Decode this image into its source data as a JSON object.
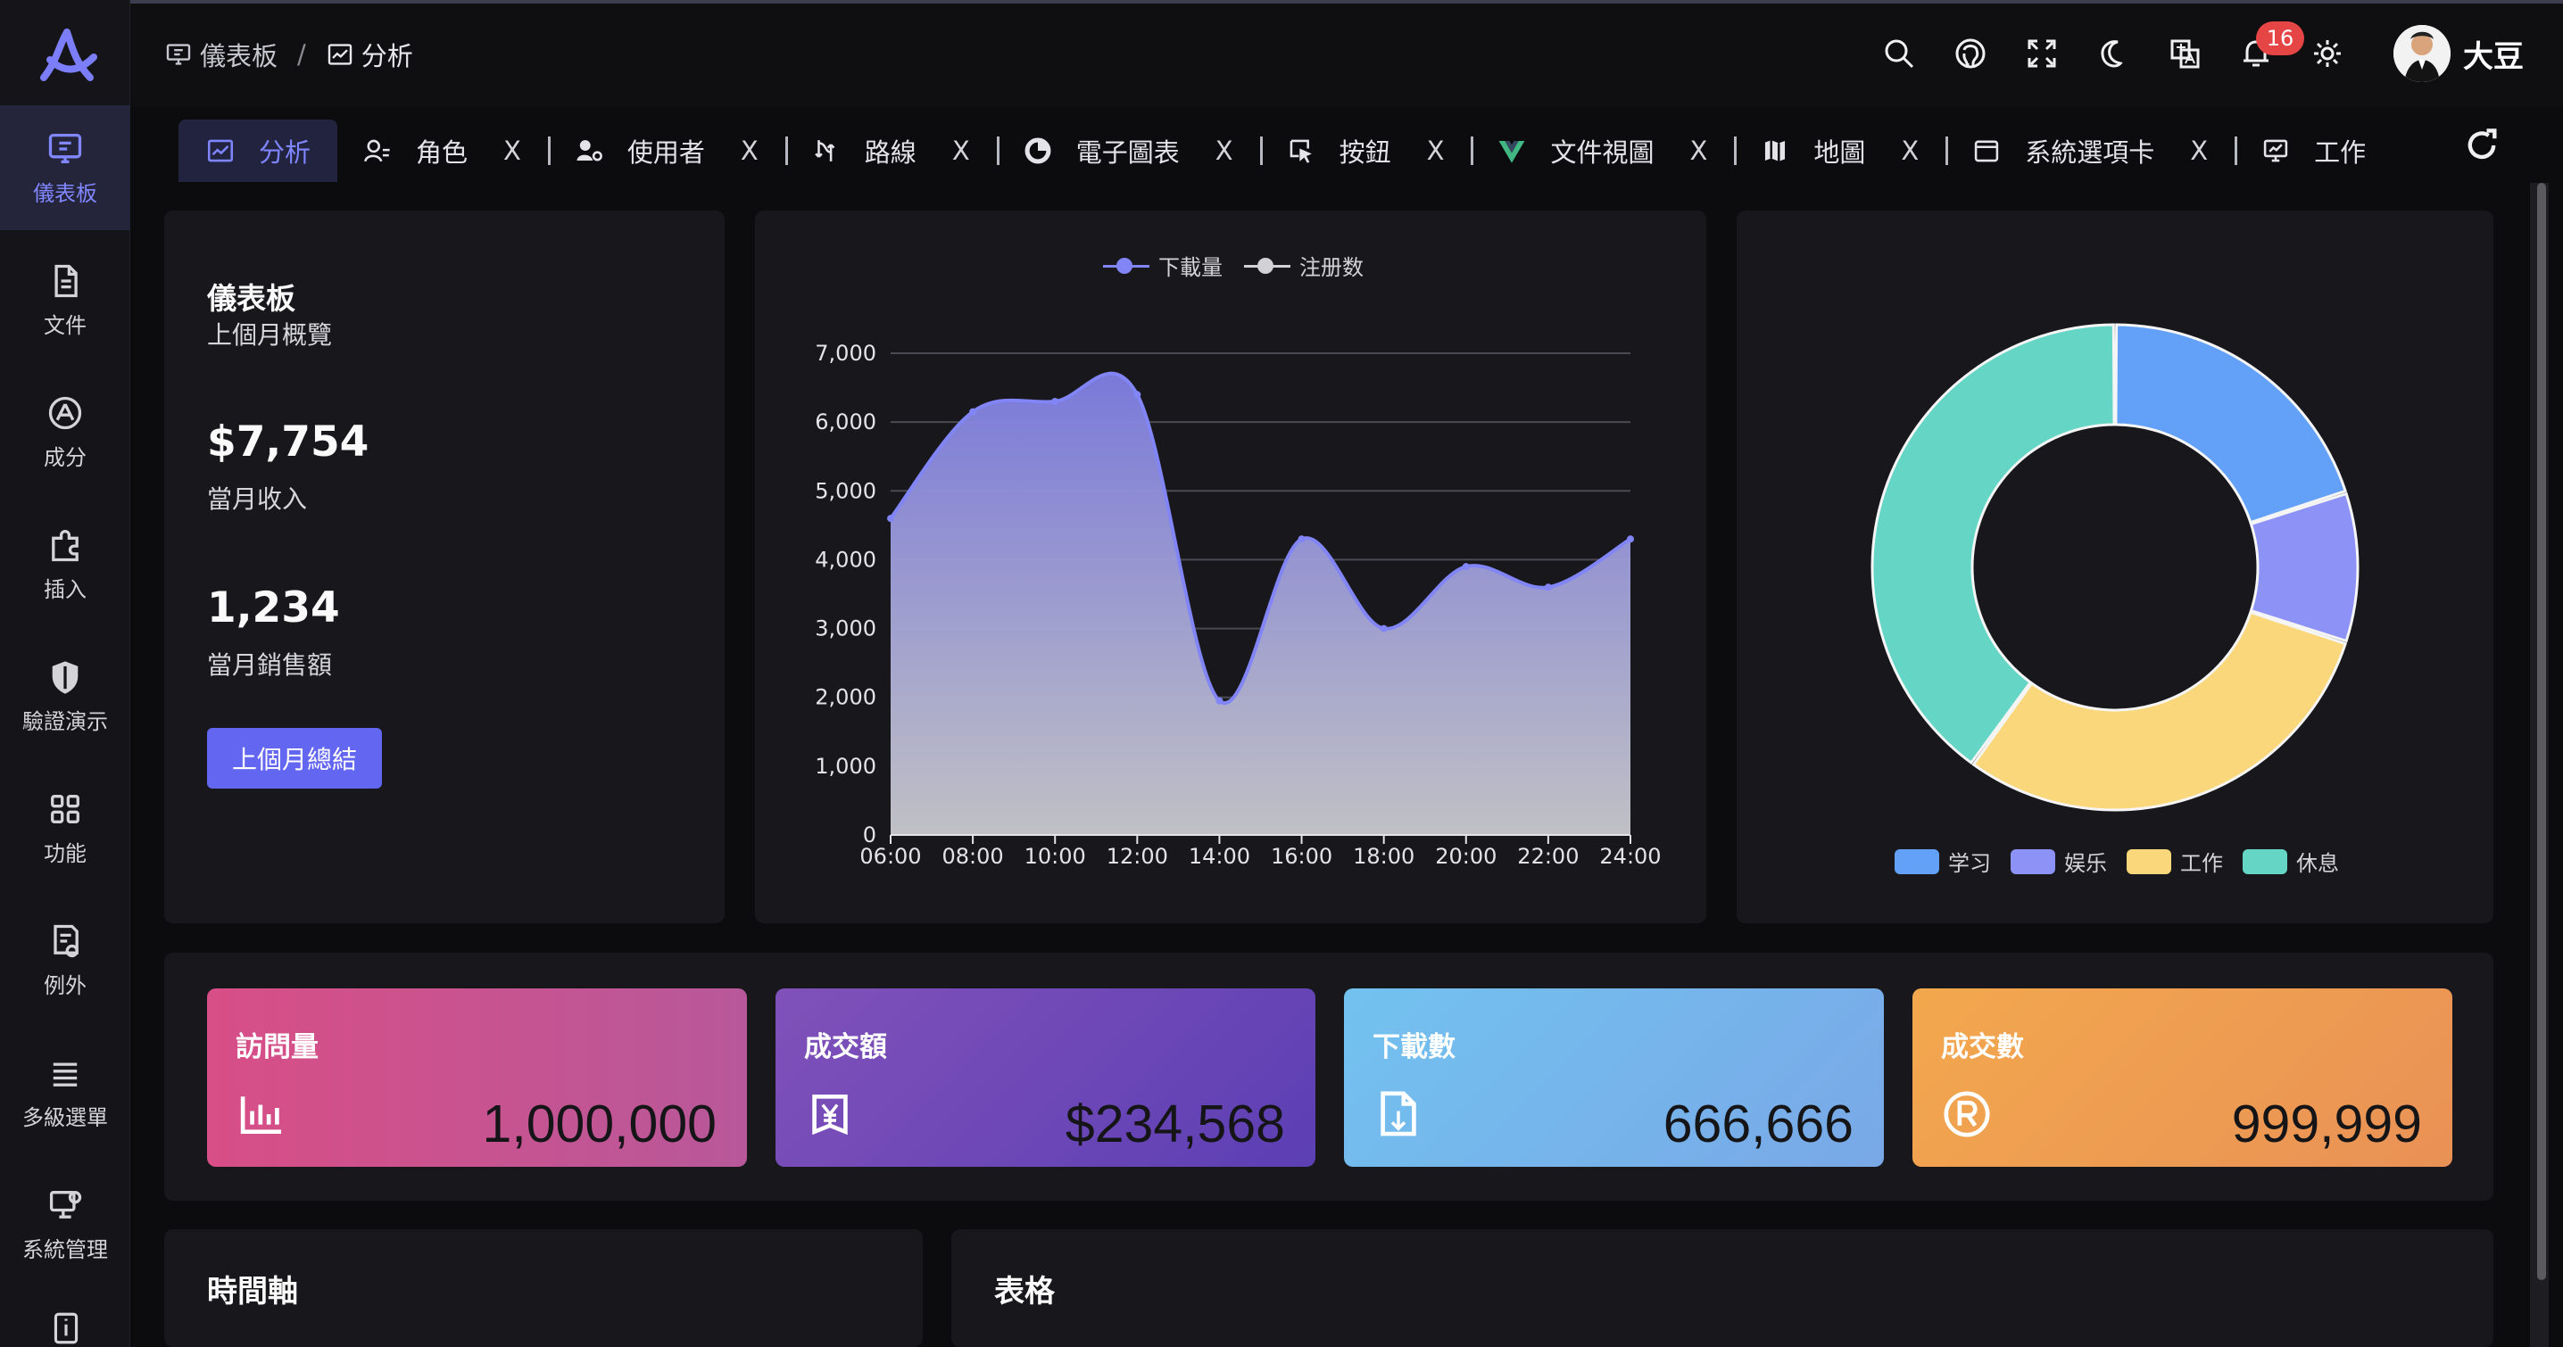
{
  "sidebar": {
    "items": [
      {
        "label": "儀表板",
        "icon": "dashboard-icon"
      },
      {
        "label": "文件",
        "icon": "document-icon"
      },
      {
        "label": "成分",
        "icon": "component-icon"
      },
      {
        "label": "插入",
        "icon": "puzzle-icon"
      },
      {
        "label": "驗證演示",
        "icon": "shield-icon"
      },
      {
        "label": "功能",
        "icon": "grid-icon"
      },
      {
        "label": "例外",
        "icon": "exception-icon"
      },
      {
        "label": "多級選單",
        "icon": "menu-icon"
      },
      {
        "label": "系統管理",
        "icon": "system-icon"
      }
    ]
  },
  "breadcrumb": {
    "items": [
      "儀表板",
      "分析"
    ],
    "separator": "/"
  },
  "header": {
    "notification_count": "16",
    "user_name": "大豆"
  },
  "tabs": [
    {
      "label": "分析",
      "active": true
    },
    {
      "label": "角色"
    },
    {
      "label": "使用者"
    },
    {
      "label": "路線"
    },
    {
      "label": "電子圖表"
    },
    {
      "label": "按鈕"
    },
    {
      "label": "文件視圖"
    },
    {
      "label": "地圖"
    },
    {
      "label": "系統選項卡"
    },
    {
      "label": "工作"
    }
  ],
  "tab_close_label": "X",
  "overview": {
    "title": "儀表板",
    "subtitle": "上個月概覽",
    "revenue_value": "$7,754",
    "revenue_label": "當月收入",
    "sales_value": "1,234",
    "sales_label": "當月銷售額",
    "button_label": "上個月總結"
  },
  "line_chart": {
    "legend": [
      "下載量",
      "注册数"
    ]
  },
  "chart_data": [
    {
      "type": "area",
      "x": [
        "06:00",
        "08:00",
        "10:00",
        "12:00",
        "14:00",
        "16:00",
        "18:00",
        "20:00",
        "22:00",
        "24:00"
      ],
      "series": [
        {
          "name": "下載量",
          "values": [
            4600,
            6150,
            6300,
            6400,
            1950,
            4300,
            3000,
            3900,
            3600,
            4300
          ]
        },
        {
          "name": "注册数",
          "values": []
        }
      ],
      "yticks": [
        "0",
        "1,000",
        "2,000",
        "3,000",
        "4,000",
        "5,000",
        "6,000",
        "7,000"
      ],
      "ylim": [
        0,
        7000
      ],
      "grid": true,
      "legend_position": "top-center"
    },
    {
      "type": "pie",
      "donut": true,
      "categories": [
        "学习",
        "娱乐",
        "工作",
        "休息"
      ],
      "values": [
        20,
        10,
        30,
        40
      ],
      "legend_position": "bottom-center",
      "colors": [
        "#63a1f8",
        "#8c92f6",
        "#f9d77a",
        "#65d6c6"
      ]
    }
  ],
  "stats": [
    {
      "title": "訪問量",
      "value": "1,000,000",
      "icon": "bar-chart-icon"
    },
    {
      "title": "成交額",
      "value": "$234,568",
      "icon": "yen-icon"
    },
    {
      "title": "下載數",
      "value": "666,666",
      "icon": "download-file-icon"
    },
    {
      "title": "成交數",
      "value": "999,999",
      "icon": "registered-icon"
    }
  ],
  "bottom": {
    "timeline_title": "時間軸",
    "table_title": "表格"
  },
  "colors": {
    "accent": "#6366f1",
    "area_stroke": "#8185f5",
    "area_top": "#7f7ee3",
    "area_bottom": "#c9c9ce"
  }
}
